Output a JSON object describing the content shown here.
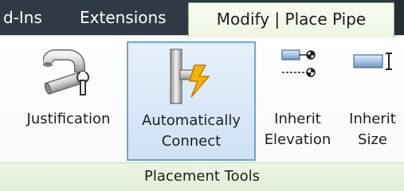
{
  "tabs": [
    {
      "label": "d-Ins",
      "active": false
    },
    {
      "label": "Extensions",
      "active": false
    },
    {
      "label": "Modify | Place Pipe",
      "active": true
    }
  ],
  "tools": [
    {
      "label_line1": "Justification",
      "label_line2": "",
      "icon": "pipe-wrench-icon",
      "selected": false
    },
    {
      "label_line1": "Automatically",
      "label_line2": "Connect",
      "icon": "pipe-connect-lightning-icon",
      "selected": true
    },
    {
      "label_line1": "Inherit",
      "label_line2": "Elevation",
      "icon": "inherit-elevation-icon",
      "selected": false
    },
    {
      "label_line1": "Inherit",
      "label_line2": "Size",
      "icon": "inherit-size-icon",
      "selected": false
    }
  ],
  "panel": {
    "title": "Placement Tools"
  },
  "colors": {
    "tabbar_bg": "#2f3a44",
    "active_tab_bg": "#eef6e4",
    "selected_tool_bg": "#cfe1f5",
    "selected_tool_border": "#6fa3d8",
    "footer_bg": "#e2eed6"
  }
}
